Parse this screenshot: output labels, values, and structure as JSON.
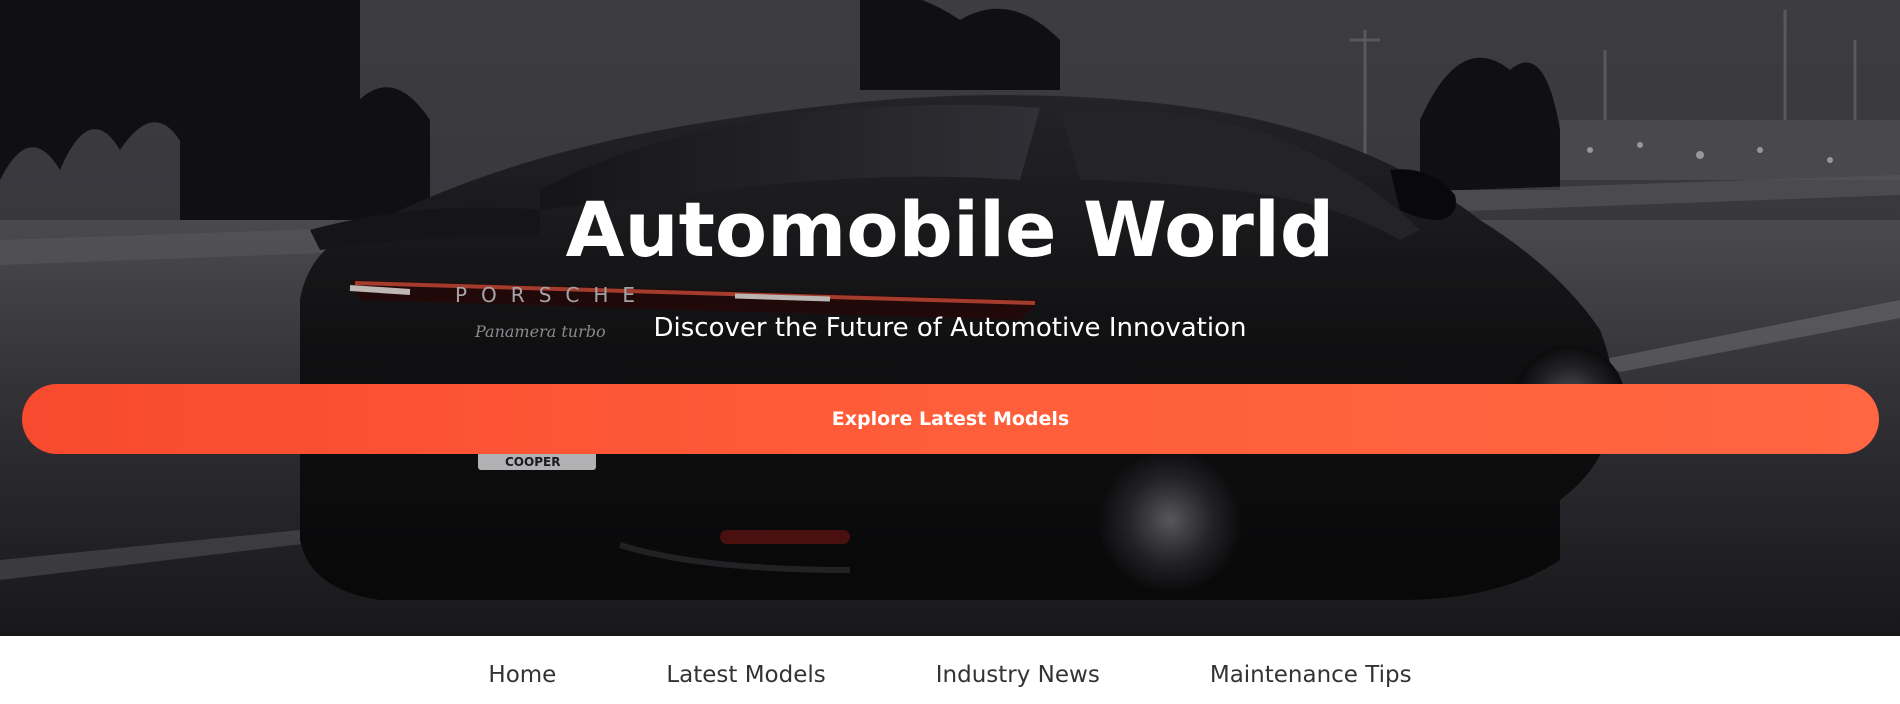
{
  "hero": {
    "title": "Automobile World",
    "subtitle": "Discover the Future of Automotive Innovation",
    "cta_label": "Explore Latest Models",
    "background_image": "dark-sports-car-photo",
    "car_badge_text": "PORSCHE",
    "car_model_script": "Panamera turbo",
    "plate_text": "COOPER"
  },
  "nav": {
    "items": [
      {
        "label": "Home"
      },
      {
        "label": "Latest Models"
      },
      {
        "label": "Industry News"
      },
      {
        "label": "Maintenance Tips"
      }
    ]
  },
  "colors": {
    "accent": "#ff5a36",
    "accent_start": "#f84a2e",
    "accent_end": "#ff6641",
    "text_light": "#ffffff",
    "text_dark": "#333333",
    "nav_bg": "#ffffff"
  }
}
